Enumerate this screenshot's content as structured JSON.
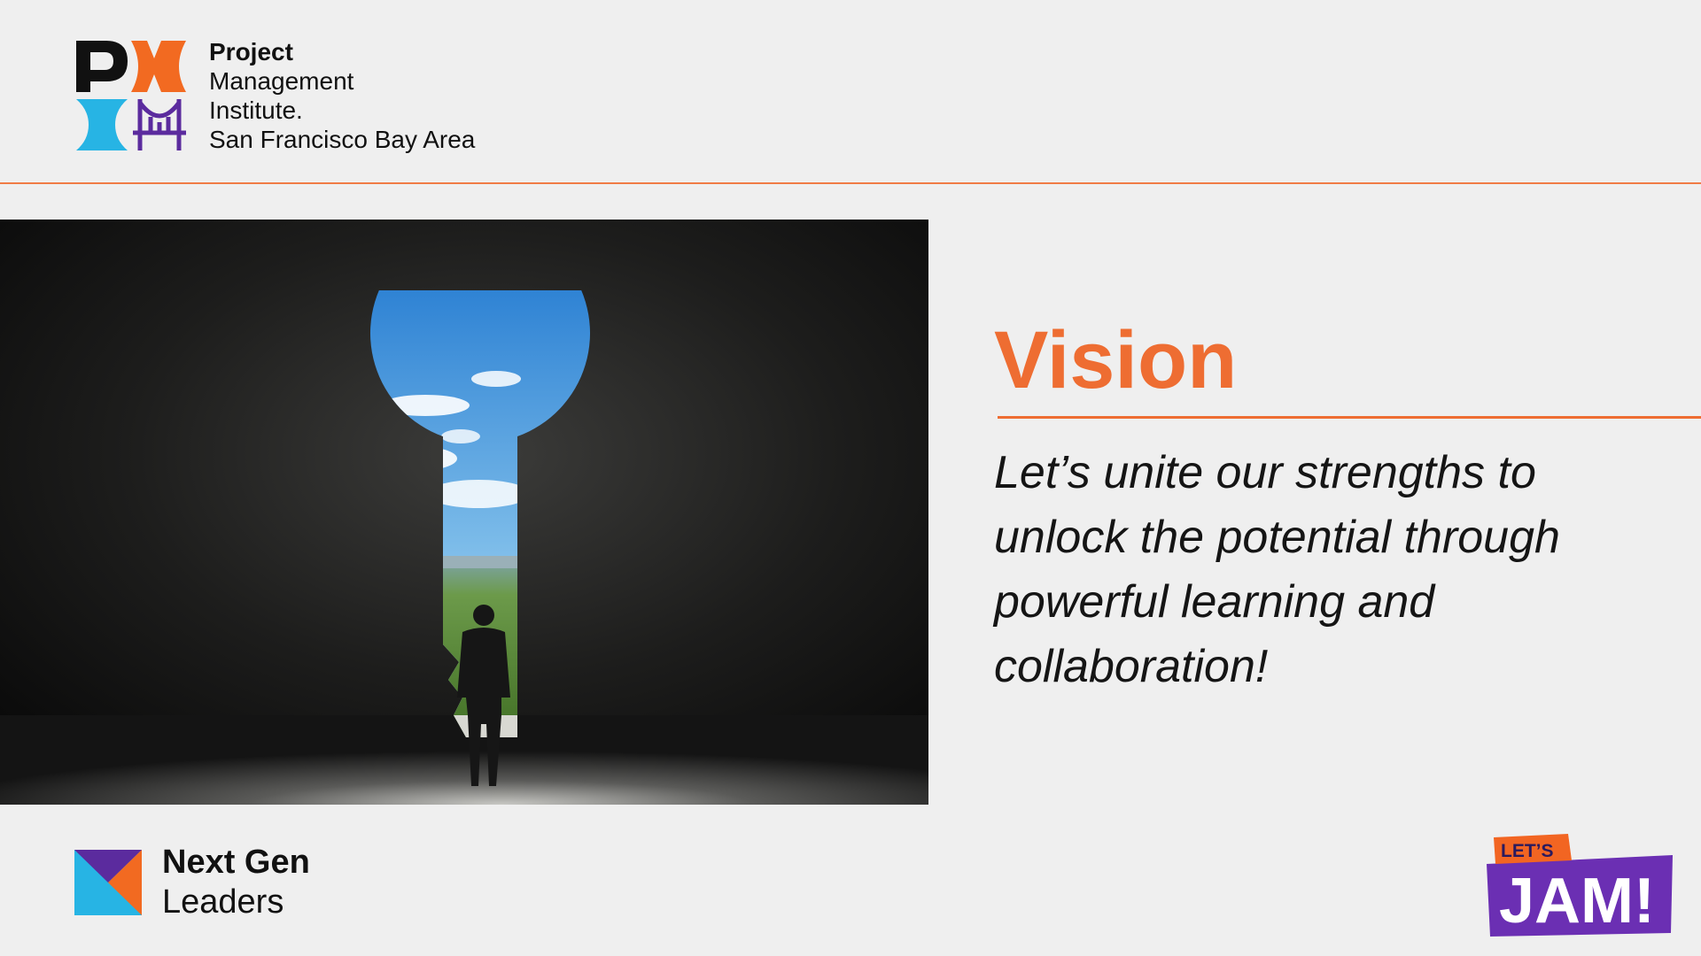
{
  "header": {
    "org_line1": "Project",
    "org_line2": "Management",
    "org_line3": "Institute.",
    "org_line4": "San Francisco Bay Area"
  },
  "main": {
    "title": "Vision",
    "statement": "Let’s unite our strengths to unlock the potential through powerful learning and collaboration!",
    "image_icon": "keyhole-door-icon"
  },
  "footer": {
    "group_line1": "Next Gen",
    "group_line2": "Leaders",
    "badge_small": "LET’S",
    "badge_large": "JAM!"
  },
  "colors": {
    "background": "#efefef",
    "accent": "#ee6d32",
    "pmi_black": "#111111",
    "pmi_orange": "#f26a21",
    "pmi_cyan": "#27b4e4",
    "pmi_purple": "#5b2b9e",
    "badge_purple": "#6b2fb3",
    "badge_orange": "#f26522"
  }
}
